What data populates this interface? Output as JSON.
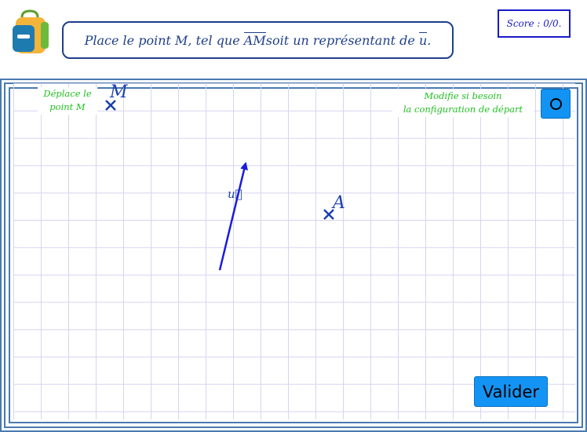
{
  "instruction": {
    "prefix": "Place le point M, tel que ",
    "vector_name": "AM",
    "middle": " soit un représentant de ",
    "vector_u": "u",
    "suffix": "."
  },
  "score": "Score : 0/0.",
  "hints": {
    "drag_line1": "Déplace le",
    "drag_line2": "point M",
    "config_line1": "Modifie si besoin",
    "config_line2": "la configuration de départ"
  },
  "points": {
    "M_label": "M",
    "A_label": "A",
    "u_label": "u⃗"
  },
  "buttons": {
    "validate": "Valider",
    "options_icon": "circle-icon"
  },
  "colors": {
    "instruction": "#1f3f8a",
    "score": "#1a1ac8",
    "points": "#1a3fb0",
    "hints": "#22c022",
    "buttons": "#1394f4",
    "grid": "#d8d4f0"
  }
}
